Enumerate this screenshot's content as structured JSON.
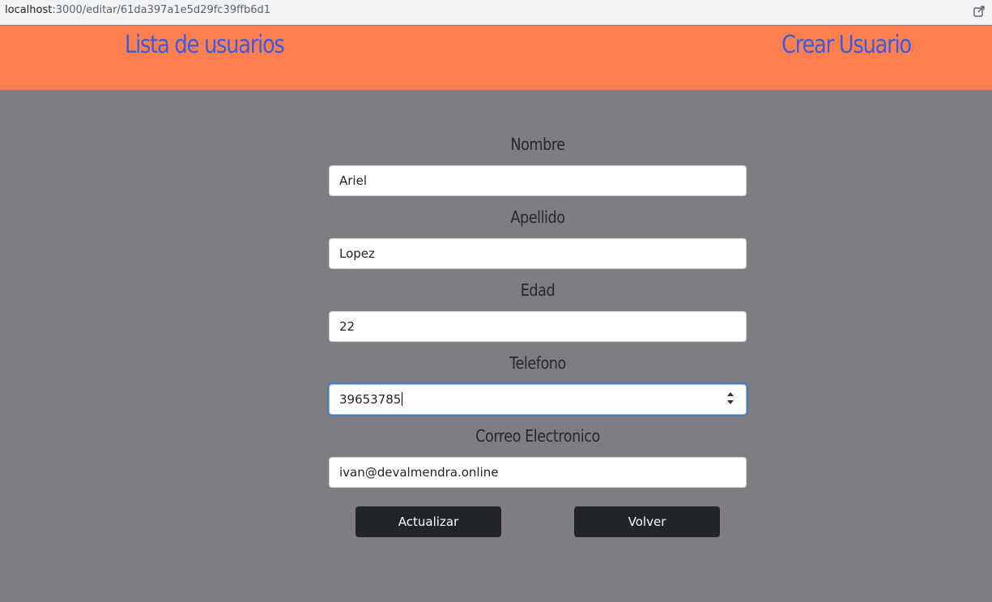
{
  "browser": {
    "url_host": "localhost",
    "url_path": ":3000/editar/61da397a1e5d29fc39ffb6d1"
  },
  "nav": {
    "list_users_label": "Lista de usuarios",
    "create_user_label": "Crear Usuario"
  },
  "colors": {
    "navbar_bg": "#ff7f50",
    "page_bg": "#807d82",
    "nav_link": "#3b5bdb",
    "button_bg": "#212529"
  },
  "form": {
    "nombre": {
      "label": "Nombre",
      "value": "Ariel"
    },
    "apellido": {
      "label": "Apellido",
      "value": "Lopez"
    },
    "edad": {
      "label": "Edad",
      "value": "22"
    },
    "telefono": {
      "label": "Telefono",
      "value": "39653785"
    },
    "correo": {
      "label": "Correo Electronico",
      "value": "ivan@devalmendra.online"
    }
  },
  "buttons": {
    "update_label": "Actualizar",
    "back_label": "Volver"
  }
}
